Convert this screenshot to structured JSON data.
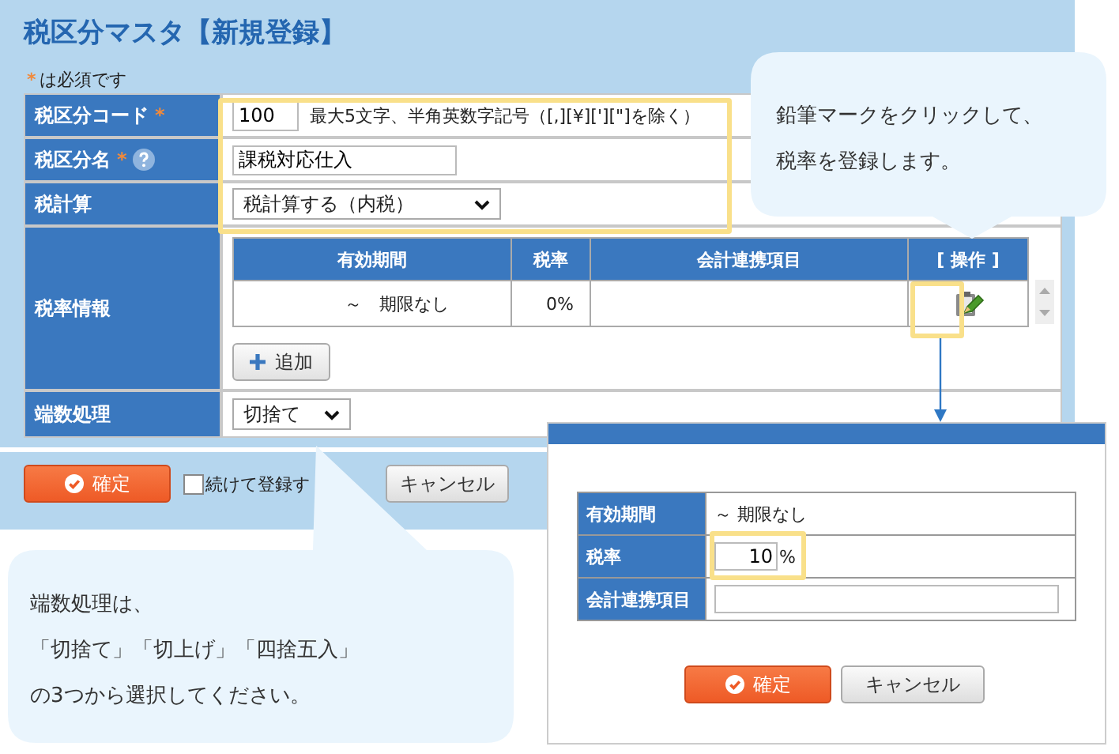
{
  "title": "税区分マスタ【新規登録】",
  "required_note": {
    "mark": "*",
    "text": "は必須です"
  },
  "form_rows": [
    {
      "kind": "text_input",
      "label": "税区分コード",
      "required_mark": "*",
      "value": "100",
      "hint": "最大5文字、半角英数字記号（[,][¥]['][\"]を除く）"
    },
    {
      "kind": "text_input",
      "label": "税区分名",
      "required_mark": "*",
      "help": true,
      "value": "課税対応仕入"
    },
    {
      "kind": "dropdown",
      "label": "税計算",
      "value": "税計算する（内税）"
    },
    {
      "kind": "rate_table",
      "label": "税率情報"
    },
    {
      "kind": "dropdown",
      "label": "端数処理",
      "value": "切捨て"
    }
  ],
  "rate_table": {
    "columns": [
      "有効期間",
      "税率",
      "会計連携項目",
      "[ 操作 ]"
    ],
    "rows": [
      {
        "period": "～　期限なし",
        "rate": "0%"
      }
    ],
    "add_button": "追加"
  },
  "footer": {
    "confirm_button": "確定",
    "continue_checkbox": {
      "label": "続けて登録す",
      "checked": false
    },
    "cancel_button": "キャンセル"
  },
  "callouts": [
    {
      "lines": [
        "鉛筆マークをクリックして、",
        "税率を登録します。"
      ]
    },
    {
      "lines": [
        "端数処理は、",
        "「切捨て」「切上げ」「四捨五入」",
        "の3つから選択してください。"
      ]
    }
  ],
  "dialog": {
    "rows": [
      {
        "kind": "text",
        "label": "有効期間",
        "value": "～ 期限なし"
      },
      {
        "kind": "input",
        "label": "税率",
        "value": "10",
        "unit": "%"
      },
      {
        "kind": "input",
        "label": "会計連携項目"
      }
    ],
    "confirm_button": "確定",
    "cancel_button": "キャンセル"
  }
}
